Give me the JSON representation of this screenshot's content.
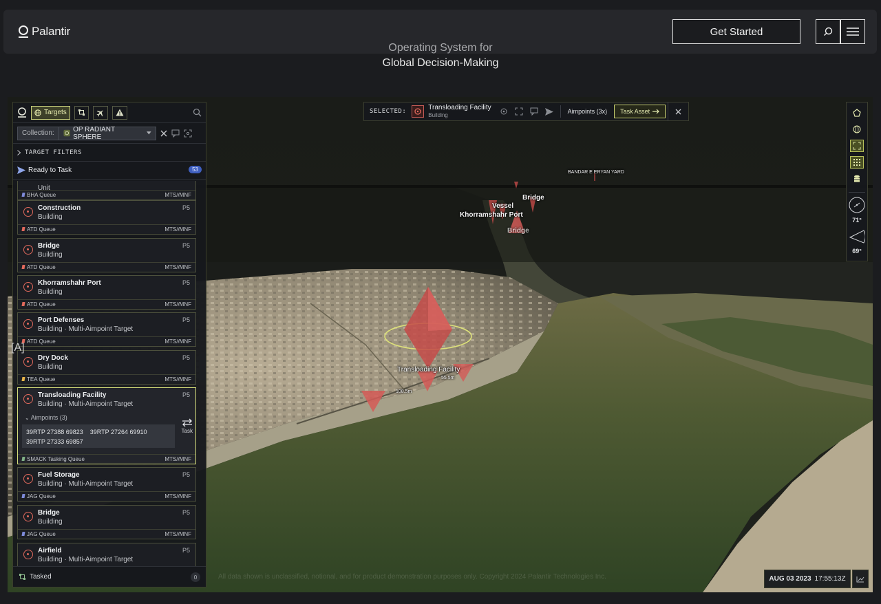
{
  "header": {
    "brand": "Palantir",
    "cta": "Get Started",
    "tagline_line1": "Operating System for",
    "tagline_line2": "Global Decision-Making"
  },
  "panel": {
    "targets_tab": "Targets",
    "collection_label": "Collection:",
    "collection_value": "OP RADIANT SPHERE",
    "filters_label": "TARGET FILTERS",
    "ready_label": "Ready to Task",
    "ready_count": "53",
    "tasked_label": "Tasked",
    "tasked_count": "0",
    "partial_top": {
      "sub": "Unit",
      "queue": "BHA Queue",
      "class": "MTS//MNF"
    },
    "cards": [
      {
        "name": "Construction",
        "sub": "Building",
        "prio": "P5",
        "queue": "ATD Queue",
        "class": "MTS//MNF",
        "dot": "#e0695c"
      },
      {
        "name": "Bridge",
        "sub": "Building",
        "prio": "P5",
        "queue": "ATD Queue",
        "class": "MTS//MNF",
        "dot": "#e0695c"
      },
      {
        "name": "Khorramshahr Port",
        "sub": "Building",
        "prio": "P5",
        "queue": "ATD Queue",
        "class": "MTS//MNF",
        "dot": "#e0695c"
      },
      {
        "name": "Port Defenses",
        "sub": "Building · Multi-Aimpoint Target",
        "prio": "P5",
        "queue": "ATD Queue",
        "class": "MTS//MNF",
        "dot": "#e0695c"
      },
      {
        "name": "Dry Dock",
        "sub": "Building",
        "prio": "P5",
        "queue": "TEA Queue",
        "class": "MTS//MNF",
        "dot": "#e7b34a"
      }
    ],
    "selected_card": {
      "name": "Transloading Facility",
      "sub": "Building · Multi-Aimpoint Target",
      "prio": "P5",
      "aimpoints_label": "Aimpoints (3)",
      "aimpoints": [
        "39RTP 27388 69823",
        "39RTP 27264 69910",
        "39RTP 27333 69857"
      ],
      "task_label": "Task",
      "queue": "SMACK Tasking Queue",
      "class": "MTS//MNF"
    },
    "cards_after": [
      {
        "name": "Fuel Storage",
        "sub": "Building · Multi-Aimpoint Target",
        "prio": "P5",
        "queue": "JAG Queue",
        "class": "MTS//MNF"
      },
      {
        "name": "Bridge",
        "sub": "Building",
        "prio": "P5",
        "queue": "JAG Queue",
        "class": "MTS//MNF"
      },
      {
        "name": "Airfield",
        "sub": "Building · Multi-Aimpoint Target",
        "prio": "P5"
      }
    ]
  },
  "selection": {
    "label": "SELECTED:",
    "name": "Transloading Facility",
    "type": "Building",
    "aimpoints": "Aimpoints (3x)",
    "task_asset": "Task Asset"
  },
  "rail": {
    "heading1": "71°",
    "heading2": "69°"
  },
  "map": {
    "labels": {
      "bandar": "BANDAR E ERYAN YARD",
      "bridge_top": "Bridge",
      "vessel": "Vessel",
      "port": "Khorramshahr Port",
      "bridge_mid": "Bridge",
      "facility": "Transloading Facility",
      "dist1": "55.5m",
      "dist2": "108.5m"
    },
    "disclaimer": "All data shown is unclassified, notional, and for product demonstration purposes only. Copyright 2024 Palantir Technologies Inc.",
    "timestamp_date": "AUG 03 2023",
    "timestamp_time": "17:55:13Z"
  },
  "side_marker": "[A]"
}
